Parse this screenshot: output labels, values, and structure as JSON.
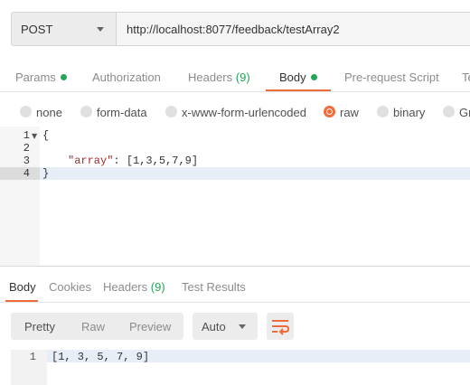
{
  "request": {
    "method": "POST",
    "url": "http://localhost:8077/feedback/testArray2"
  },
  "request_tabs": {
    "params": "Params",
    "authorization": "Authorization",
    "headers": "Headers",
    "headers_count": "(9)",
    "body": "Body",
    "pre_request": "Pre-request Script",
    "tests": "Te"
  },
  "body_types": {
    "none": "none",
    "form_data": "form-data",
    "urlencoded": "x-www-form-urlencoded",
    "raw": "raw",
    "binary": "binary",
    "graphql": "Gr",
    "selected": "raw"
  },
  "editor": {
    "line_numbers": [
      "1",
      "2",
      "3",
      "4"
    ],
    "line1": "{",
    "line3_key": "\"array\"",
    "line3_colon": ": ",
    "line3_value": "[1,3,5,7,9]",
    "line4": "}"
  },
  "response_tabs": {
    "body": "Body",
    "cookies": "Cookies",
    "headers": "Headers",
    "headers_count": "(9)",
    "test_results": "Test Results"
  },
  "response_toolbar": {
    "pretty": "Pretty",
    "raw": "Raw",
    "preview": "Preview",
    "format": "Auto"
  },
  "response_body": {
    "line_number": "1",
    "content": "[1, 3, 5, 7, 9]"
  },
  "colors": {
    "accent": "#f26b3a",
    "success": "#26a45a"
  },
  "icons": {
    "method_dropdown": "chevron-down-icon",
    "format_dropdown": "chevron-down-icon",
    "wrap": "wrap-lines-icon"
  }
}
